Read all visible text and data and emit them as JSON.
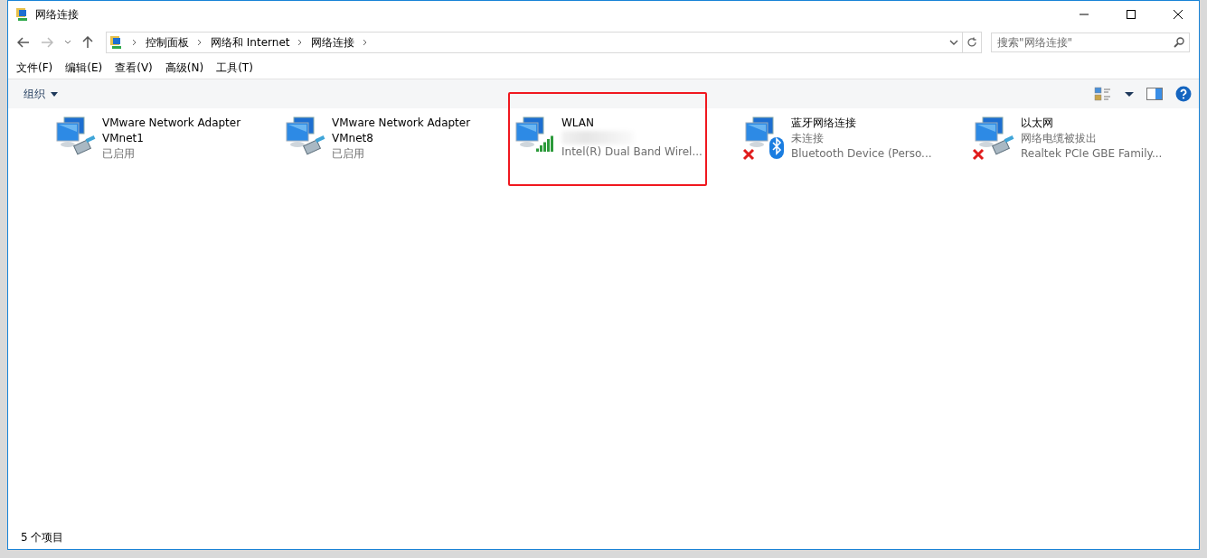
{
  "window": {
    "title": "网络连接"
  },
  "address_bar": {
    "crumbs": [
      "控制面板",
      "网络和 Internet",
      "网络连接"
    ]
  },
  "search": {
    "placeholder": "搜索\"网络连接\""
  },
  "menu": [
    "文件(F)",
    "编辑(E)",
    "查看(V)",
    "高级(N)",
    "工具(T)"
  ],
  "toolbar": {
    "organize": "组织"
  },
  "connections": [
    {
      "name": "VMware Network Adapter VMnet1",
      "status": "已启用",
      "kind": "cable",
      "disconnected": false,
      "highlighted": false,
      "blurred": false
    },
    {
      "name": "VMware Network Adapter VMnet8",
      "status": "已启用",
      "kind": "cable",
      "disconnected": false,
      "highlighted": false,
      "blurred": false
    },
    {
      "name": "WLAN",
      "device": "Intel(R) Dual Band Wirel...",
      "kind": "signal",
      "disconnected": false,
      "highlighted": true,
      "blurred": true
    },
    {
      "name": "蓝牙网络连接",
      "status": "未连接",
      "device": "Bluetooth Device (Perso...",
      "kind": "bluetooth",
      "disconnected": true,
      "highlighted": false,
      "blurred": false
    },
    {
      "name": "以太网",
      "status": "网络电缆被拔出",
      "device": "Realtek PCIe GBE Family...",
      "kind": "cable",
      "disconnected": true,
      "highlighted": false,
      "blurred": false
    }
  ],
  "status_bar": {
    "count": "5 个项目"
  }
}
